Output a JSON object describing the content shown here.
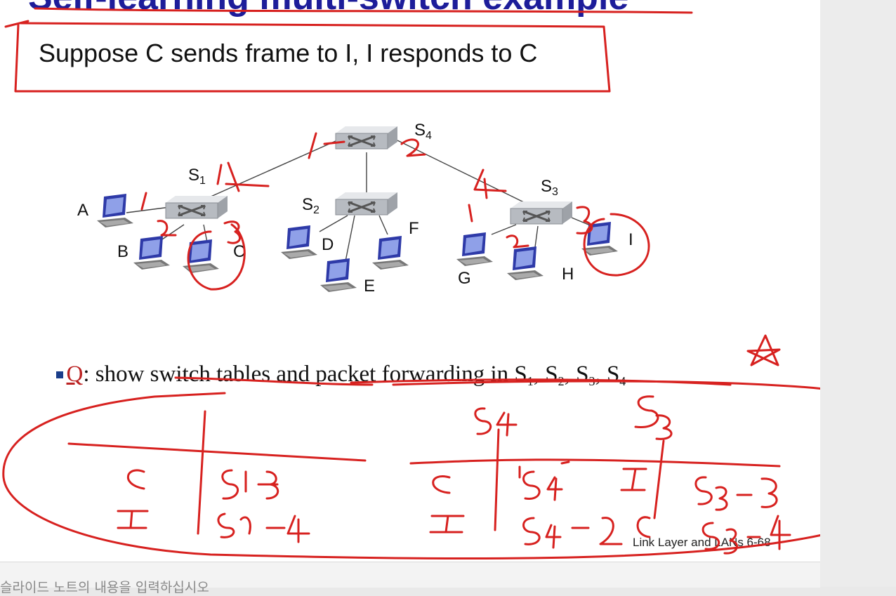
{
  "slide": {
    "title": "Self-learning multi-switch example",
    "subtitle": "Suppose C sends frame to I, I responds to C",
    "switches": [
      "S",
      "S",
      "S",
      "S"
    ],
    "switch_subs": [
      "1",
      "2",
      "3",
      "4"
    ],
    "hosts": [
      "A",
      "B",
      "C",
      "D",
      "E",
      "F",
      "G",
      "H",
      "I"
    ],
    "question": {
      "letter": "Q",
      "text": ": show switch tables and packet forwarding in S",
      "subs": [
        "1",
        "2",
        "3",
        "4"
      ]
    },
    "footer": "Link Layer and LANs  6-68"
  },
  "notes_hint": "슬라이드 노트의 내용을 입력하십시오"
}
